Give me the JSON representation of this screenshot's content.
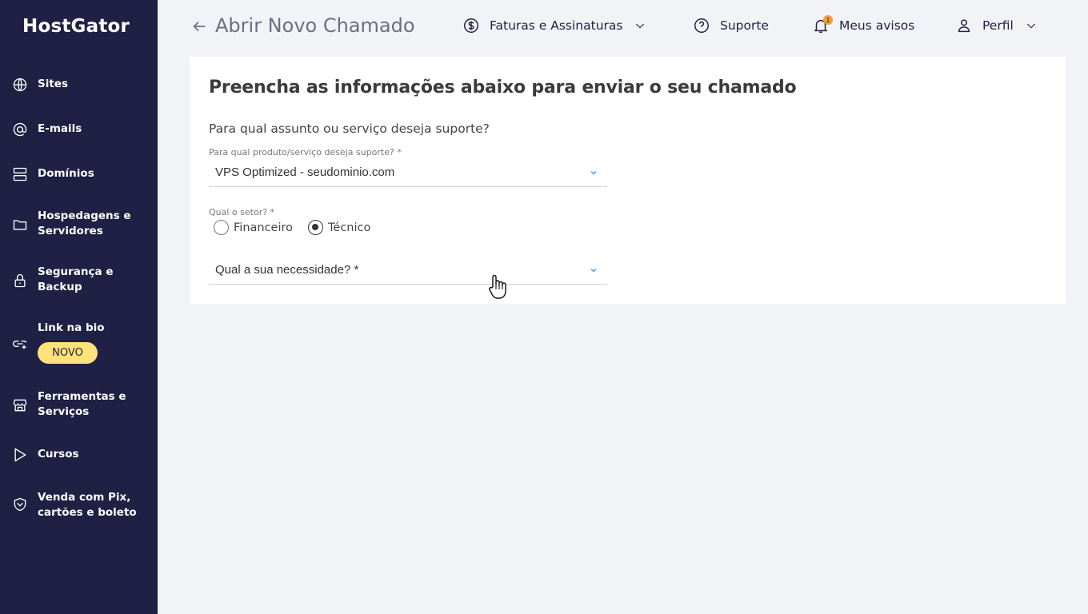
{
  "app": {
    "logo": "HostGator"
  },
  "sidebar": {
    "items": [
      {
        "label": "Sites",
        "icon": "globe-icon"
      },
      {
        "label": "E-mails",
        "icon": "at-icon"
      },
      {
        "label": "Domínios",
        "icon": "server-icon"
      },
      {
        "label": "Hospedagens e Servidores",
        "icon": "folder-icon"
      },
      {
        "label": "Segurança e Backup",
        "icon": "lock-icon"
      },
      {
        "label": "Link na bio",
        "icon": "link-icon",
        "badge": "NOVO"
      },
      {
        "label": "Ferramentas e Serviços",
        "icon": "store-icon"
      },
      {
        "label": "Cursos",
        "icon": "play-icon"
      },
      {
        "label": "Venda com Pix, cartões e boleto",
        "icon": "shield-icon"
      }
    ]
  },
  "header": {
    "title": "Abrir Novo Chamado",
    "billing": "Faturas e Assinaturas",
    "support": "Suporte",
    "notices": "Meus avisos",
    "notices_count": "1",
    "profile": "Perfil"
  },
  "form": {
    "heading": "Preencha as informações abaixo para enviar o seu chamado",
    "question": "Para qual assunto ou serviço deseja suporte?",
    "product_label": "Para qual produto/serviço deseja suporte? *",
    "product_value": "VPS Optimized - seudominio.com",
    "sector_label": "Qual o setor? *",
    "sector_options": [
      "Financeiro",
      "Técnico"
    ],
    "sector_selected": "Técnico",
    "need_placeholder": "Qual a sua necessidade? *"
  },
  "colors": {
    "sidebar_bg": "#1f2044",
    "badge": "#ffe27a",
    "notif": "#f29d38",
    "accent": "#5aa9e6"
  }
}
